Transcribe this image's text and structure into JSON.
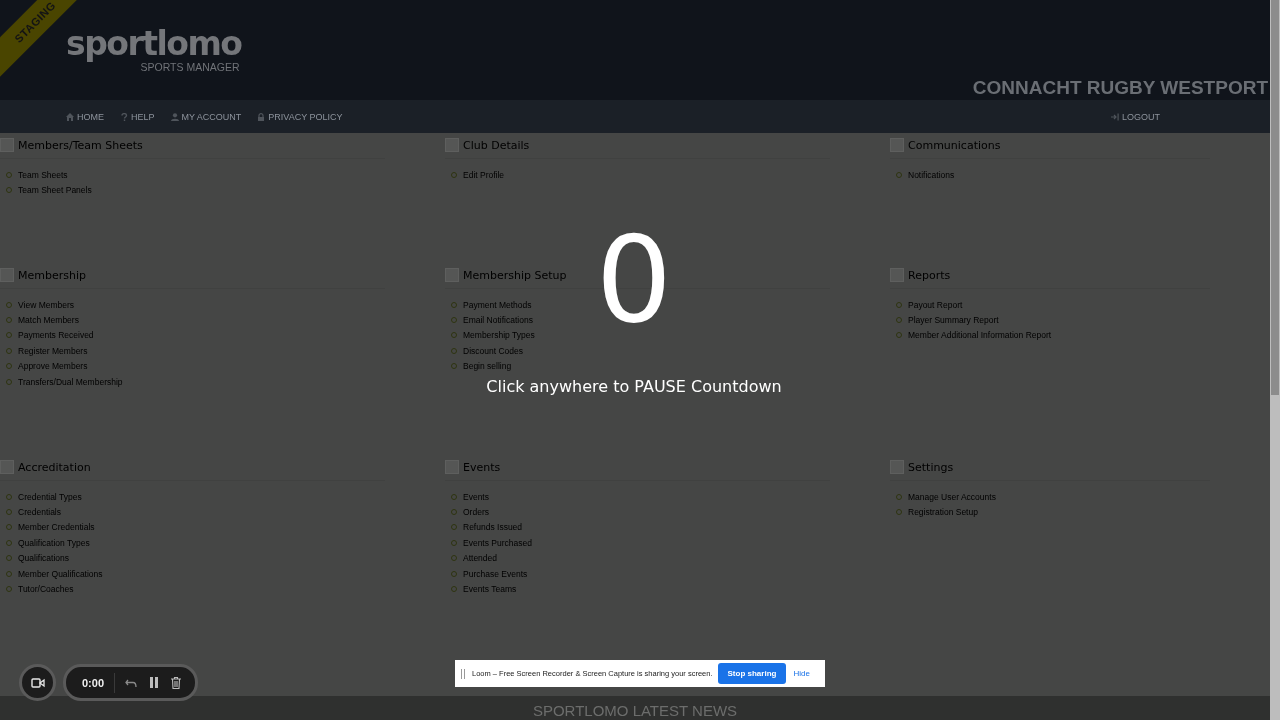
{
  "header": {
    "ribbon": "STAGING",
    "logo": "sportlomo",
    "logo_subtitle": "SPORTS MANAGER",
    "club_name": "CONNACHT RUGBY WESTPORT"
  },
  "nav": {
    "items": [
      {
        "kind": "home",
        "label": "HOME"
      },
      {
        "kind": "help",
        "label": "HELP"
      },
      {
        "kind": "user",
        "label": "MY ACCOUNT"
      },
      {
        "kind": "lock",
        "label": "PRIVACY POLICY"
      }
    ],
    "logout": {
      "kind": "logout",
      "label": "LOGOUT"
    }
  },
  "sections": [
    {
      "title": "Members/Team Sheets",
      "items": [
        "Team Sheets",
        "Team Sheet Panels"
      ]
    },
    {
      "title": "Club Details",
      "items": [
        "Edit Profile"
      ]
    },
    {
      "title": "Communications",
      "items": [
        "Notifications"
      ]
    },
    {
      "title": "Membership",
      "items": [
        "View Members",
        "Match Members",
        "Payments Received",
        "Register Members",
        "Approve Members",
        "Transfers/Dual Membership"
      ]
    },
    {
      "title": "Membership Setup",
      "items": [
        "Payment Methods",
        "Email Notifications",
        "Membership Types",
        "Discount Codes",
        "Begin selling"
      ]
    },
    {
      "title": "Reports",
      "items": [
        "Payout Report",
        "Player Summary Report",
        "Member Additional Information Report"
      ]
    },
    {
      "title": "Accreditation",
      "items": [
        "Credential Types",
        "Credentials",
        "Member Credentials",
        "Qualification Types",
        "Qualifications",
        "Member Qualifications",
        "Tutor/Coaches"
      ]
    },
    {
      "title": "Events",
      "items": [
        "Events",
        "Orders",
        "Refunds Issued",
        "Events Purchased",
        "Attended",
        "Purchase Events",
        "Events Teams"
      ]
    },
    {
      "title": "Settings",
      "items": [
        "Manage User Accounts",
        "Registration Setup"
      ]
    }
  ],
  "news_heading": "SPORTLOMO LATEST NEWS",
  "countdown": {
    "number": "0",
    "hint": "Click anywhere to PAUSE Countdown"
  },
  "recorder": {
    "time": "0:00"
  },
  "share_bar": {
    "message": "Loom – Free Screen Recorder & Screen Capture is sharing your screen.",
    "stop_button": "Stop sharing",
    "hide_link": "Hide"
  }
}
